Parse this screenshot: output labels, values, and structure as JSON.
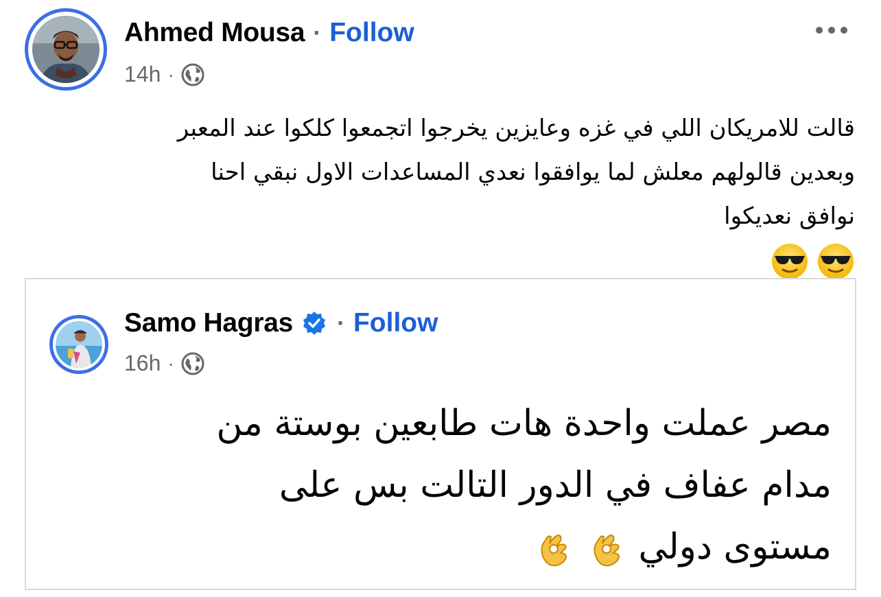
{
  "post": {
    "author": "Ahmed Mousa",
    "separator": "·",
    "follow_label": "Follow",
    "time": "14h",
    "meta_separator": "·",
    "audience_icon": "globe-icon",
    "more_icon": "more-horizontal-icon",
    "text_lines": [
      "قالت للامريكان اللي في غزه وعايزين يخرجوا اتجمعوا كلكوا عند المعبر",
      "وبعدين قالولهم معلش لما يوافقوا نعدي المساعدات الاول نبقي احنا",
      "نوافق نعديكوا"
    ],
    "emojis": [
      "smiling-face-with-sunglasses",
      "smiling-face-with-sunglasses"
    ]
  },
  "shared": {
    "author": "Samo Hagras",
    "verified_icon": "verified-badge-icon",
    "separator": "·",
    "follow_label": "Follow",
    "time": "16h",
    "meta_separator": "·",
    "audience_icon": "globe-icon",
    "text_lines": [
      "مصر عملت واحدة هات طابعين بوستة من",
      "مدام عفاف في الدور التالت بس على",
      "مستوى دولي"
    ],
    "emojis": [
      "ok-hand",
      "ok-hand"
    ]
  },
  "colors": {
    "accent": "#1b5fd6",
    "avatar_ring": "#3b6fe4",
    "secondary_text": "#65676b",
    "card_border": "#d8d9dc"
  }
}
